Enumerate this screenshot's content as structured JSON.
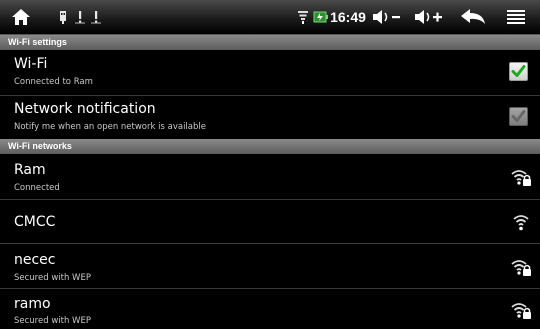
{
  "status_bar": {
    "time": "16:49",
    "icons": [
      "home-icon",
      "usb-icon",
      "warning-icon",
      "warning-icon",
      "wifi-icon",
      "battery-icon",
      "volume-down-icon",
      "volume-up-icon",
      "back-icon",
      "menu-icon"
    ]
  },
  "sections": {
    "wifi_settings": "Wi-Fi settings",
    "wifi_networks": "Wi-Fi networks"
  },
  "settings": {
    "wifi": {
      "title": "Wi-Fi",
      "summary": "Connected to Ram",
      "checked": true
    },
    "network_notification": {
      "title": "Network notification",
      "summary": "Notify me when an open network is available",
      "checked": true,
      "enabled": false
    }
  },
  "networks": [
    {
      "ssid": "Ram",
      "status": "Connected",
      "icon": "wifi-locked-icon"
    },
    {
      "ssid": "CMCC",
      "status": "",
      "icon": "wifi-open-icon"
    },
    {
      "ssid": "necec",
      "status": "Secured with WEP",
      "icon": "wifi-locked-icon"
    },
    {
      "ssid": "ramo",
      "status": "Secured with WEP",
      "icon": "wifi-locked-icon"
    }
  ]
}
